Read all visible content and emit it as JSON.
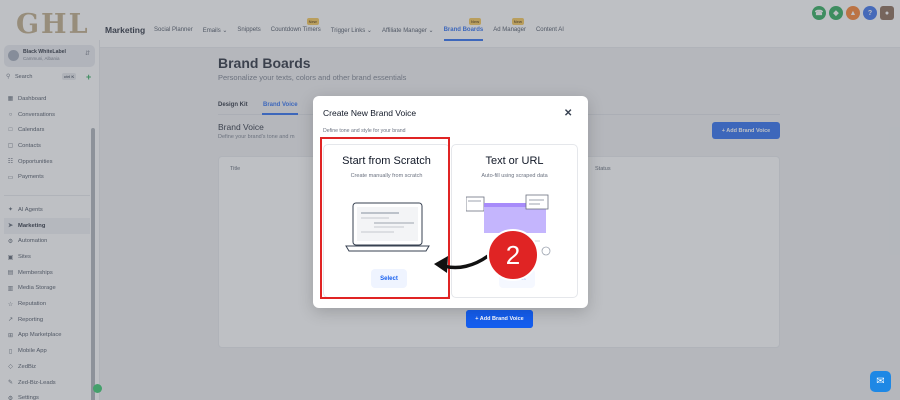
{
  "brand": {
    "logo_text": "GHL",
    "logo_color": "#b8a27a"
  },
  "header": {
    "app_title": "Marketing",
    "nav": [
      {
        "label": "Social Planner",
        "badge": ""
      },
      {
        "label": "Emails ⌄",
        "badge": ""
      },
      {
        "label": "Snippets",
        "badge": ""
      },
      {
        "label": "Countdown Timers",
        "badge": "New"
      },
      {
        "label": "Trigger Links ⌄",
        "badge": ""
      },
      {
        "label": "Affiliate Manager ⌄",
        "badge": ""
      },
      {
        "label": "Brand Boards",
        "badge": "New",
        "active": true
      },
      {
        "label": "Ad Manager",
        "badge": "New"
      },
      {
        "label": "Content AI",
        "badge": ""
      }
    ],
    "icons": [
      {
        "name": "phone-icon",
        "glyph": "☎",
        "color": "#16a34a"
      },
      {
        "name": "megaphone-icon",
        "glyph": "◆",
        "color": "#16a34a"
      },
      {
        "name": "bell-icon",
        "glyph": "▲",
        "color": "#f97316"
      },
      {
        "name": "help-icon",
        "glyph": "?",
        "color": "#2563eb"
      },
      {
        "name": "user-avatar-icon",
        "glyph": "●",
        "color": "#7c5a43"
      }
    ]
  },
  "sidebar": {
    "account_name": "Black WhiteLabel",
    "account_location": "Cammuni, Albania",
    "search_label": "Search",
    "search_shortcut": "ctrl K",
    "items_top": [
      {
        "label": "Dashboard",
        "icon": "▦",
        "icon_name": "dashboard-icon"
      },
      {
        "label": "Conversations",
        "icon": "○",
        "icon_name": "chat-icon"
      },
      {
        "label": "Calendars",
        "icon": "□",
        "icon_name": "calendar-icon"
      },
      {
        "label": "Contacts",
        "icon": "▢",
        "icon_name": "contacts-icon"
      },
      {
        "label": "Opportunities",
        "icon": "☷",
        "icon_name": "opportunities-icon"
      },
      {
        "label": "Payments",
        "icon": "▭",
        "icon_name": "payments-icon"
      }
    ],
    "items_bottom": [
      {
        "label": "AI Agents",
        "icon": "✦",
        "icon_name": "ai-agents-icon"
      },
      {
        "label": "Marketing",
        "icon": "➤",
        "icon_name": "marketing-icon",
        "active": true
      },
      {
        "label": "Automation",
        "icon": "⚙",
        "icon_name": "automation-icon"
      },
      {
        "label": "Sites",
        "icon": "▣",
        "icon_name": "sites-icon"
      },
      {
        "label": "Memberships",
        "icon": "▤",
        "icon_name": "memberships-icon"
      },
      {
        "label": "Media Storage",
        "icon": "▥",
        "icon_name": "media-storage-icon"
      },
      {
        "label": "Reputation",
        "icon": "☆",
        "icon_name": "reputation-icon"
      },
      {
        "label": "Reporting",
        "icon": "↗",
        "icon_name": "reporting-icon"
      },
      {
        "label": "App Marketplace",
        "icon": "⊞",
        "icon_name": "app-marketplace-icon"
      },
      {
        "label": "Mobile App",
        "icon": "▯",
        "icon_name": "mobile-app-icon"
      },
      {
        "label": "ZedBiz",
        "icon": "◇",
        "icon_name": "zedbiz-icon"
      },
      {
        "label": "Zed-Biz-Leads",
        "icon": "✎",
        "icon_name": "zed-biz-leads-icon"
      },
      {
        "label": "Settings",
        "icon": "⚙",
        "icon_name": "settings-icon"
      }
    ]
  },
  "page": {
    "title": "Brand Boards",
    "subtitle": "Personalize your texts, colors and other brand essentials",
    "tabs": [
      "Design Kit",
      "Brand Voice"
    ],
    "section_title": "Brand Voice",
    "section_desc": "Define your brand's tone and m",
    "add_button": "+ Add Brand Voice",
    "table_headers": [
      "Title",
      "Status"
    ],
    "empty_add_button": "+ Add Brand Voice"
  },
  "modal": {
    "title": "Create New Brand Voice",
    "subtitle": "Define tone and style for your brand",
    "close_glyph": "✕",
    "options": [
      {
        "title": "Start from Scratch",
        "desc": "Create manually from scratch",
        "button": "Select"
      },
      {
        "title": "Text or URL",
        "desc": "Auto-fill using scraped data",
        "button": "Select"
      }
    ]
  },
  "annotation": {
    "step_number": "2",
    "highlight_color": "#e02424"
  },
  "help_widget": {
    "glyph": "✉"
  }
}
